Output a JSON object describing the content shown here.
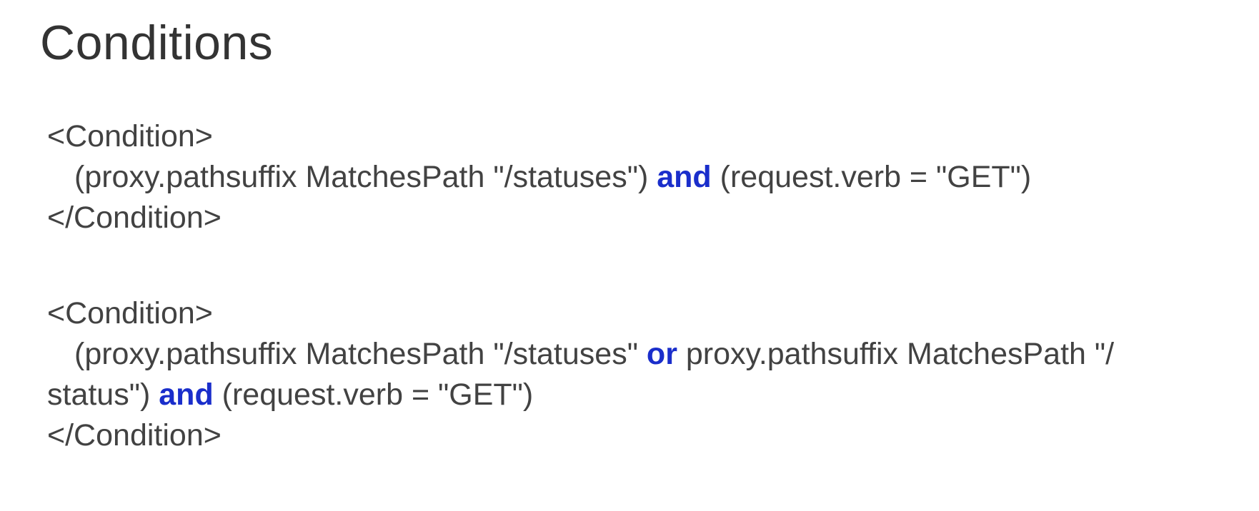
{
  "title": "Conditions",
  "colors": {
    "text": "#424242",
    "keyword": "#1a2ecb"
  },
  "condition_1": {
    "open_tag": "<Condition>",
    "expr_part_1": "(proxy.pathsuffix MatchesPath \"/statuses\") ",
    "keyword_1": "and",
    "expr_part_2": " (request.verb = \"GET\")",
    "close_tag": "</Condition>"
  },
  "condition_2": {
    "open_tag": "<Condition>",
    "expr_part_1": "(proxy.pathsuffix MatchesPath \"/statuses\" ",
    "keyword_1": "or",
    "expr_part_2": " proxy.pathsuffix MatchesPath \"/",
    "expr_part_3": "status\") ",
    "keyword_2": "and",
    "expr_part_4": " (request.verb = \"GET\")",
    "close_tag": "</Condition>"
  }
}
